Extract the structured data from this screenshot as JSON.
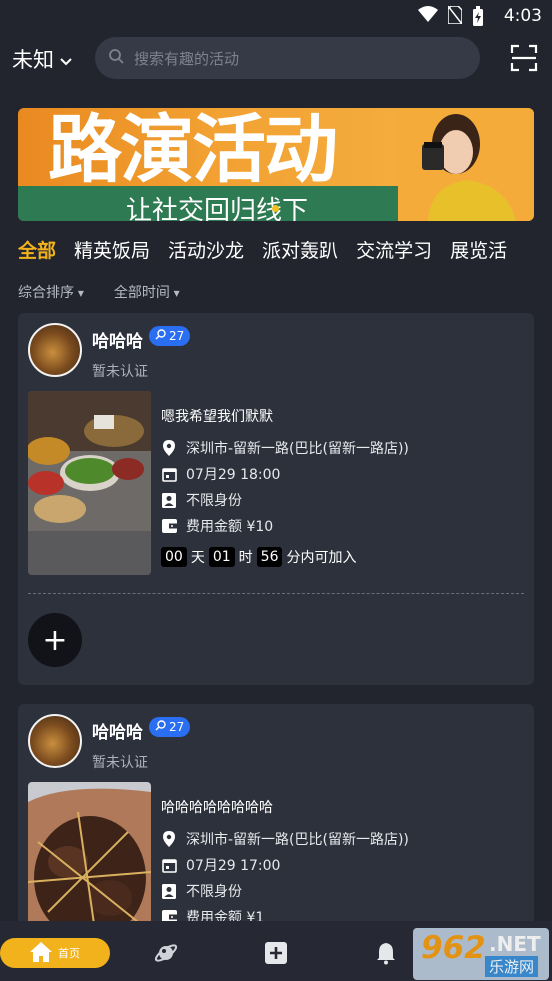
{
  "status_bar": {
    "time": "4:03"
  },
  "header": {
    "location": "未知",
    "search_placeholder": "搜索有趣的活动"
  },
  "banner": {
    "title": "路演活动",
    "subtitle": "让社交回归线下"
  },
  "tabs": [
    "全部",
    "精英饭局",
    "活动沙龙",
    "派对轰趴",
    "交流学习",
    "展览活"
  ],
  "filters": [
    "综合排序",
    "全部时间"
  ],
  "cards": [
    {
      "user": "哈哈哈",
      "badge": "27",
      "cert": "暂未认证",
      "title": "嗯我希望我们默默",
      "location": "深圳市-留新一路(巴比(留新一路店))",
      "time": "07月29 18:00",
      "identity": "不限身份",
      "fee": "费用金额 ¥10",
      "countdown": {
        "days": "00",
        "days_label": "天",
        "hours": "01",
        "hours_label": "时",
        "minutes": "56",
        "suffix": "分内可加入"
      }
    },
    {
      "user": "哈哈哈",
      "badge": "27",
      "cert": "暂未认证",
      "title": "哈哈哈哈哈哈哈哈",
      "location": "深圳市-留新一路(巴比(留新一路店))",
      "time": "07月29 17:00",
      "identity": "不限身份",
      "fee": "费用金额 ¥1"
    }
  ],
  "bottom_nav": {
    "home_label": "首页"
  },
  "watermark": {
    "brand": "962",
    "suffix": ".NET",
    "sub": "乐游网"
  },
  "colors": {
    "accent": "#f2b21c",
    "badge": "#2a6ef2",
    "background": "#22252e",
    "card": "#2d313c"
  },
  "icons": [
    "wifi-icon",
    "no-sim-icon",
    "battery-icon",
    "chevron-down-icon",
    "search-icon",
    "scan-icon",
    "location-icon",
    "calendar-icon",
    "identity-icon",
    "wallet-icon",
    "plus-icon",
    "home-icon",
    "planet-icon",
    "add-square-icon",
    "bell-icon"
  ]
}
